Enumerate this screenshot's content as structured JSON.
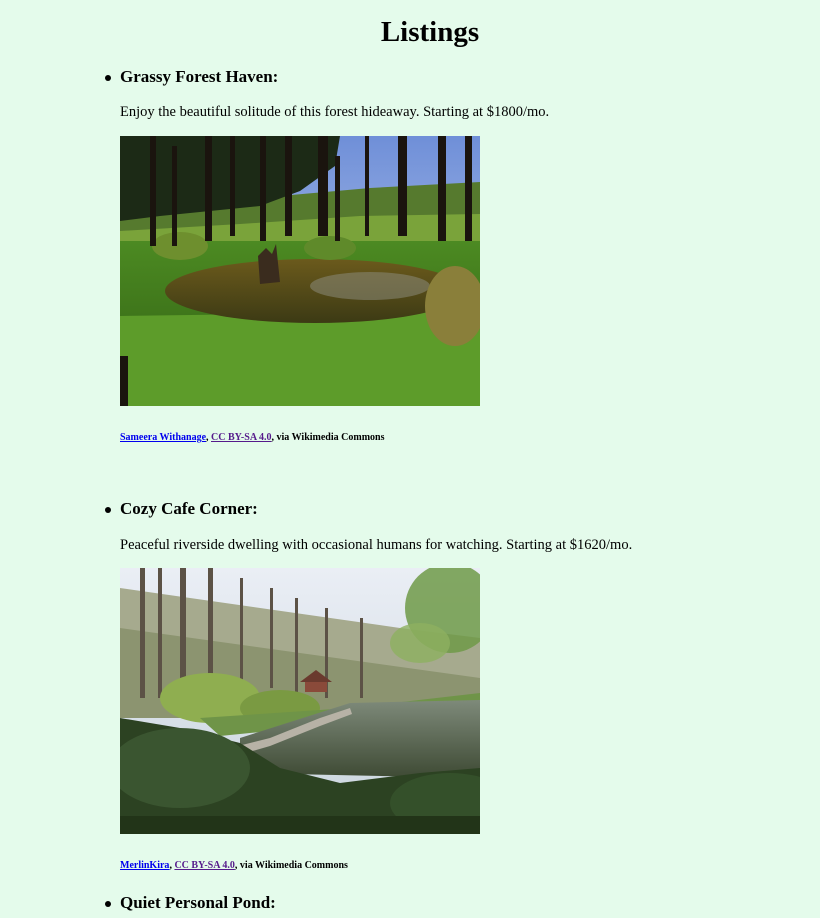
{
  "page": {
    "title": "Listings",
    "background": "#e4fbeb"
  },
  "listings": [
    {
      "name": "Grassy Forest Haven:",
      "description": "Enjoy the beautiful solitude of this forest hideaway. Starting at $1800/mo.",
      "image_alt": "Grassy Forest Haven",
      "credit": {
        "author": "Sameera Withanage",
        "sep1": ", ",
        "license": "CC BY-SA 4.0",
        "suffix": ", via Wikimedia Commons"
      }
    },
    {
      "name": "Cozy Cafe Corner:",
      "description": "Peaceful riverside dwelling with occasional humans for watching. Starting at $1620/mo.",
      "image_alt": "Cozy Cafe Corner",
      "credit": {
        "author": "MerlinKira",
        "sep1": ", ",
        "license": "CC BY-SA 4.0",
        "suffix": ", via Wikimedia Commons"
      }
    },
    {
      "name": "Quiet Personal Pond:"
    }
  ]
}
